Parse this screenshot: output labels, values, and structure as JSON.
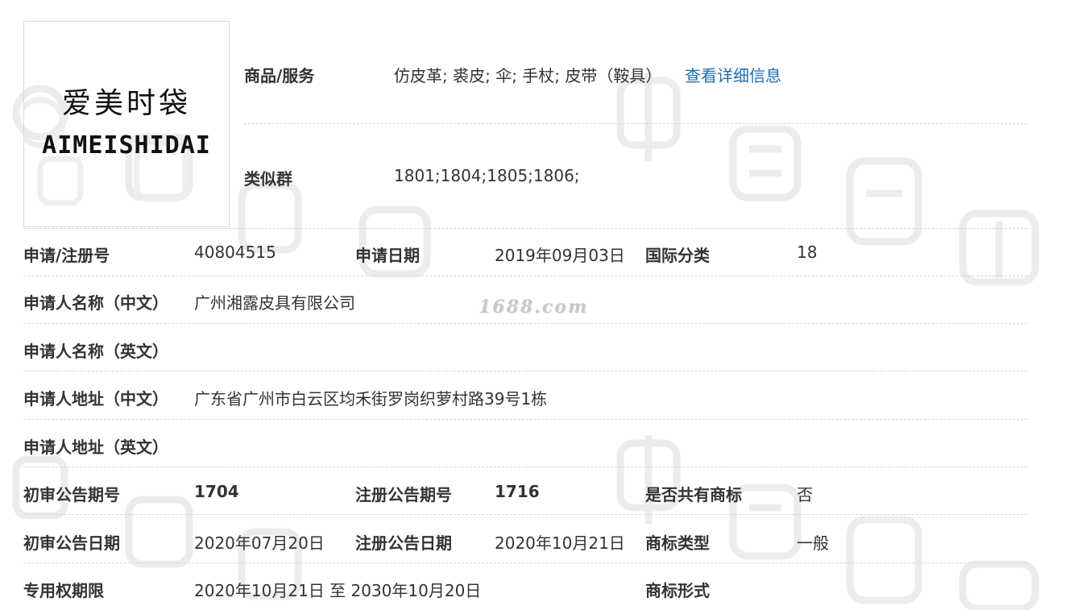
{
  "watermark": {
    "site": "1688.com"
  },
  "logo": {
    "chinese": "爱美时袋",
    "english": "AIMEISHIDAI"
  },
  "goods_services": {
    "label": "商品/服务",
    "value": "仿皮革; 裘皮; 伞; 手杖; 皮带（鞍具）",
    "link": "查看详细信息"
  },
  "similar_group": {
    "label": "类似群",
    "value": "1801;1804;1805;1806;"
  },
  "rows": {
    "reg_no": {
      "label": "申请/注册号",
      "value": "40804515"
    },
    "apply_date": {
      "label": "申请日期",
      "value": "2019年09月03日"
    },
    "intl_class": {
      "label": "国际分类",
      "value": "18"
    },
    "applicant_cn": {
      "label": "申请人名称（中文）",
      "value": "广州湘露皮具有限公司"
    },
    "applicant_en": {
      "label": "申请人名称（英文）",
      "value": ""
    },
    "address_cn": {
      "label": "申请人地址（中文）",
      "value": "广东省广州市白云区均禾街罗岗织萝村路39号1栋"
    },
    "address_en": {
      "label": "申请人地址（英文）",
      "value": ""
    },
    "prelim_issue": {
      "label": "初审公告期号",
      "value": "1704"
    },
    "reg_issue": {
      "label": "注册公告期号",
      "value": "1716"
    },
    "shared_mark": {
      "label": "是否共有商标",
      "value": "否"
    },
    "prelim_date": {
      "label": "初审公告日期",
      "value": "2020年07月20日"
    },
    "reg_date": {
      "label": "注册公告日期",
      "value": "2020年10月21日"
    },
    "mark_type": {
      "label": "商标类型",
      "value": "一般"
    },
    "exclusive_period": {
      "label": "专用权期限",
      "value": "2020年10月21日 至 2030年10月20日"
    },
    "mark_form": {
      "label": "商标形式",
      "value": ""
    }
  }
}
